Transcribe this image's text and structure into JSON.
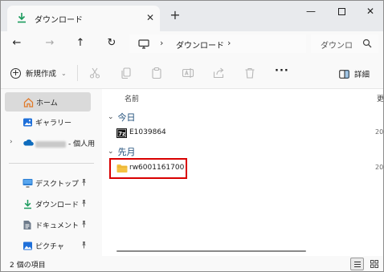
{
  "window": {
    "tab_label": "ダウンロード",
    "close_tab_glyph": "✕",
    "new_tab_glyph": "+",
    "minimize_glyph": "—",
    "close_glyph": "✕"
  },
  "address": {
    "back": "←",
    "forward": "→",
    "up": "↑",
    "refresh": "↻",
    "sep": "›",
    "segment": "ダウンロード",
    "search_placeholder": "ダウンロ"
  },
  "toolbar": {
    "new_label": "新規作成",
    "new_plus": "+",
    "new_caret": "⌄",
    "more": "···",
    "details_label": "詳細"
  },
  "nav": {
    "items": [
      {
        "label": "ホーム",
        "icon": "home-icon"
      },
      {
        "label": "ギャラリー",
        "icon": "gallery-icon"
      },
      {
        "label": "- 個人用",
        "icon": "onedrive-cloud-icon",
        "chevron": "›"
      },
      {
        "label": "デスクトップ",
        "icon": "desktop-icon",
        "pin": "📌"
      },
      {
        "label": "ダウンロード",
        "icon": "download-icon",
        "pin": "📌"
      },
      {
        "label": "ドキュメント",
        "icon": "document-icon",
        "pin": "📌"
      },
      {
        "label": "ピクチャ",
        "icon": "pictures-icon",
        "pin": "📌"
      }
    ]
  },
  "content": {
    "columns": {
      "name": "名前",
      "date": "更"
    },
    "groups": [
      {
        "label": "今日",
        "chevron": "⌄"
      },
      {
        "label": "先月",
        "chevron": "⌄"
      }
    ],
    "files": [
      {
        "name": "E1039864",
        "date": "20",
        "icon": "7zip-archive-icon"
      },
      {
        "name": "rw6001161700",
        "date": "20",
        "icon": "folder-icon"
      }
    ]
  },
  "status": {
    "count_text": "2 個の項目"
  },
  "colors": {
    "accent": "#0067c0",
    "highlight_box": "#d90000",
    "folder": "#f5c242"
  }
}
